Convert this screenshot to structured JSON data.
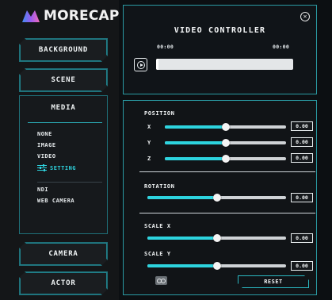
{
  "app": {
    "logo_text": "MORECAP"
  },
  "sidebar": {
    "background_label": "BACKGROUND",
    "scene_label": "SCENE",
    "camera_label": "CAMERA",
    "actor_label": "ACTOR",
    "media": {
      "title": "MEDIA",
      "items": [
        "NONE",
        "IMAGE",
        "VIDEO",
        "SETTING"
      ],
      "items2": [
        "NDI",
        "WEB CAMERA"
      ],
      "active_item": "SETTING"
    }
  },
  "video_controller": {
    "title": "VIDEO CONTROLLER",
    "current_time": "00:00",
    "total_time": "00:00",
    "progress": 0.02
  },
  "transform": {
    "position_title": "POSITION",
    "x": {
      "label": "X",
      "value_text": "0.00",
      "level": 0.5
    },
    "y": {
      "label": "Y",
      "value_text": "0.00",
      "level": 0.5
    },
    "z": {
      "label": "Z",
      "value_text": "0.00",
      "level": 0.5
    },
    "rotation": {
      "title": "ROTATION",
      "value_text": "0.00",
      "level": 0.5
    },
    "scale_x": {
      "title": "SCALE X",
      "value_text": "0.00",
      "level": 0.5
    },
    "scale_y": {
      "title": "SCALE Y",
      "value_text": "0.00",
      "level": 0.5
    },
    "reset_label": "RESET"
  },
  "colors": {
    "accent": "#2dd4df",
    "border": "#2a9aa3",
    "background": "#0a0c0e"
  },
  "icons": [
    "logo-m-icon",
    "close-icon",
    "play-icon",
    "setting-sliders-icon",
    "link-icon"
  ]
}
